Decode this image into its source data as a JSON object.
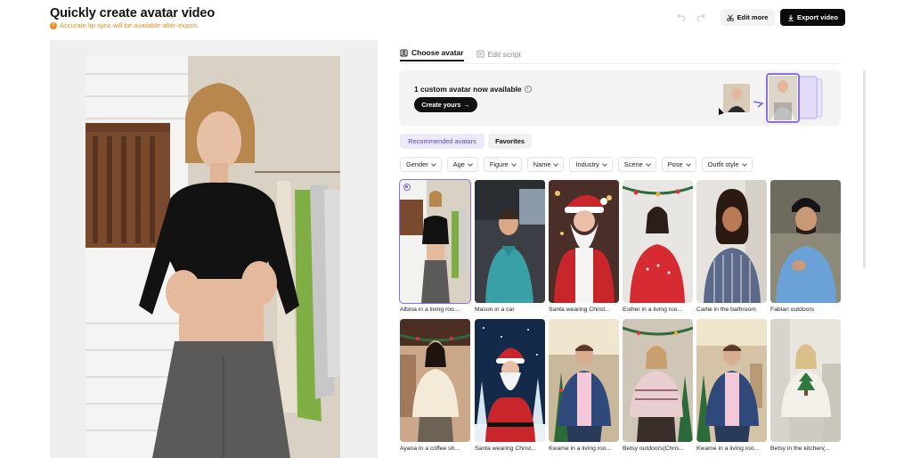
{
  "header": {
    "title": "Quickly create avatar video",
    "warning": "Accurate lip-sync will be available after-export.",
    "undo_icon": "undo-icon",
    "redo_icon": "redo-icon",
    "edit_more": "Edit more",
    "export_video": "Export video"
  },
  "tabs": [
    {
      "label": "Choose avatar",
      "active": true,
      "icon": "avatar-icon"
    },
    {
      "label": "Edit script",
      "active": false,
      "icon": "script-icon"
    }
  ],
  "banner": {
    "text": "1 custom avatar now available",
    "button": "Create yours"
  },
  "segments": {
    "recommended": "Recommended avatars",
    "favorites": "Favorites"
  },
  "filters": [
    "Gender",
    "Age",
    "Figure",
    "Name",
    "Industry",
    "Scene",
    "Pose",
    "Outfit style"
  ],
  "avatars": [
    {
      "caption": "Albina in a living roo...",
      "selected": true
    },
    {
      "caption": "Mason in a car",
      "selected": false
    },
    {
      "caption": "Santa wearing Christ...",
      "selected": false
    },
    {
      "caption": "Esther in a living roo...",
      "selected": false
    },
    {
      "caption": "Carlie in the bathroom",
      "selected": false
    },
    {
      "caption": "Fabian outdoors",
      "selected": false
    },
    {
      "caption": "Ayana in a coffee sh...",
      "selected": false
    },
    {
      "caption": "Santa wearing Christ...",
      "selected": false
    },
    {
      "caption": "Kwame in a living roo...",
      "selected": false
    },
    {
      "caption": "Betsy outdoors(Chris...",
      "selected": false
    },
    {
      "caption": "Kwame in a living roo...",
      "selected": false
    },
    {
      "caption": "Betsy in the kitchen(...",
      "selected": false
    }
  ],
  "colors": {
    "accent": "#7d5bf0",
    "warning": "#f28a1a",
    "primary_button": "#0b0b0b"
  }
}
